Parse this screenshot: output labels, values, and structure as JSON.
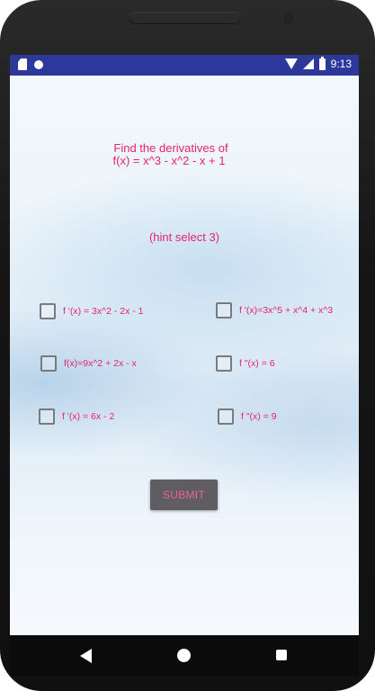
{
  "status_bar": {
    "time": "9:13",
    "icons": [
      "sd-card-icon",
      "sync-icon",
      "wifi-icon",
      "signal-icon",
      "battery-icon"
    ]
  },
  "question": {
    "line1": "Find the derivatives of",
    "line2": "f(x) = x^3 - x^2 - x + 1"
  },
  "hint": "(hint select 3)",
  "options": [
    {
      "label": "f '(x) = 3x^2 - 2x - 1",
      "checked": false
    },
    {
      "label": "f '(x)=3x^5 + x^4 + x^3",
      "checked": false
    },
    {
      "label": "f(x)=9x^2 + 2x - x",
      "checked": false
    },
    {
      "label": "f \"(x) = 6",
      "checked": false
    },
    {
      "label": "f '(x) = 6x - 2",
      "checked": false
    },
    {
      "label": "f \"(x) = 9",
      "checked": false
    }
  ],
  "submit_label": "SUBMIT",
  "nav": {
    "icons": [
      "back-icon",
      "home-icon",
      "recents-icon"
    ]
  },
  "colors": {
    "accent": "#e5246b",
    "status_bar": "#2d399a",
    "button": "#5f5d61"
  }
}
